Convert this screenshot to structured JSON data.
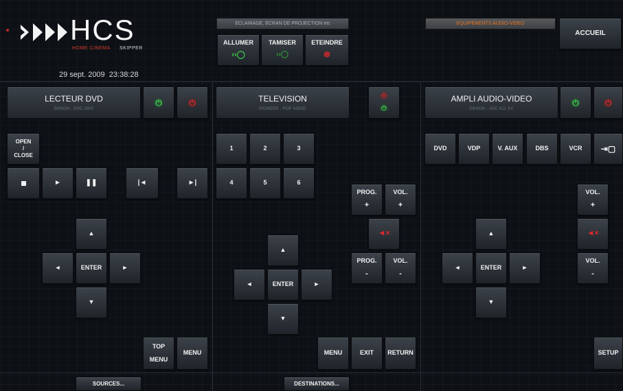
{
  "header": {
    "logo_text": "HCS",
    "logo_sub_a": "HOME CINEMA",
    "logo_sub_b": "SKIPPER",
    "datetime": "29 sept. 2009  23:38:28",
    "lighting_label": "ECLAIRAGE, ECRAN DE PROJECTION etc",
    "allumer": "ALLUMER",
    "tamiser": "TAMISER",
    "eteindre": "ETEINDRE",
    "audio_video_label": "EQUIPEMENTS AUDIO-VIDEO",
    "accueil": "ACCUEIL"
  },
  "dvd": {
    "title": "LECTEUR DVD",
    "subtitle": "DENON - DVD 3800",
    "open_a": "OPEN",
    "open_b": "/",
    "open_c": "CLOSE",
    "enter": "ENTER",
    "top_a": "TOP",
    "top_b": "MENU",
    "menu": "MENU",
    "sources": "SOURCES..."
  },
  "tv": {
    "title": "TELEVISION",
    "subtitle": "PIONEER - PDP 428XD",
    "digits": [
      "1",
      "2",
      "3",
      "4",
      "5",
      "6"
    ],
    "prog": "PROG.",
    "vol": "VOL.",
    "plus": "+",
    "minus": "-",
    "enter": "ENTER",
    "menu": "MENU",
    "exit": "EXIT",
    "return": "RETURN",
    "destinations": "DESTINATIONS..."
  },
  "ampli": {
    "title": "AMPLI AUDIO-VIDEO",
    "subtitle": "DENON - AVC A11 XV",
    "inputs": [
      "DVD",
      "VDP",
      "V. AUX",
      "DBS",
      "VCR"
    ],
    "vol": "VOL.",
    "plus": "+",
    "minus": "-",
    "enter": "ENTER",
    "setup": "SETUP"
  },
  "colors": {
    "power_on": "#3ad14a",
    "power_off": "#e0282c",
    "accent_orange": "#e8731e",
    "background": "#0d1116"
  },
  "icons": {
    "power": "power-icon",
    "stop": "stop-icon",
    "play": "play-icon",
    "pause": "pause-icon",
    "prev": "skip-previous-icon",
    "next": "skip-next-icon",
    "mute": "mute-icon",
    "input": "input-icon"
  }
}
